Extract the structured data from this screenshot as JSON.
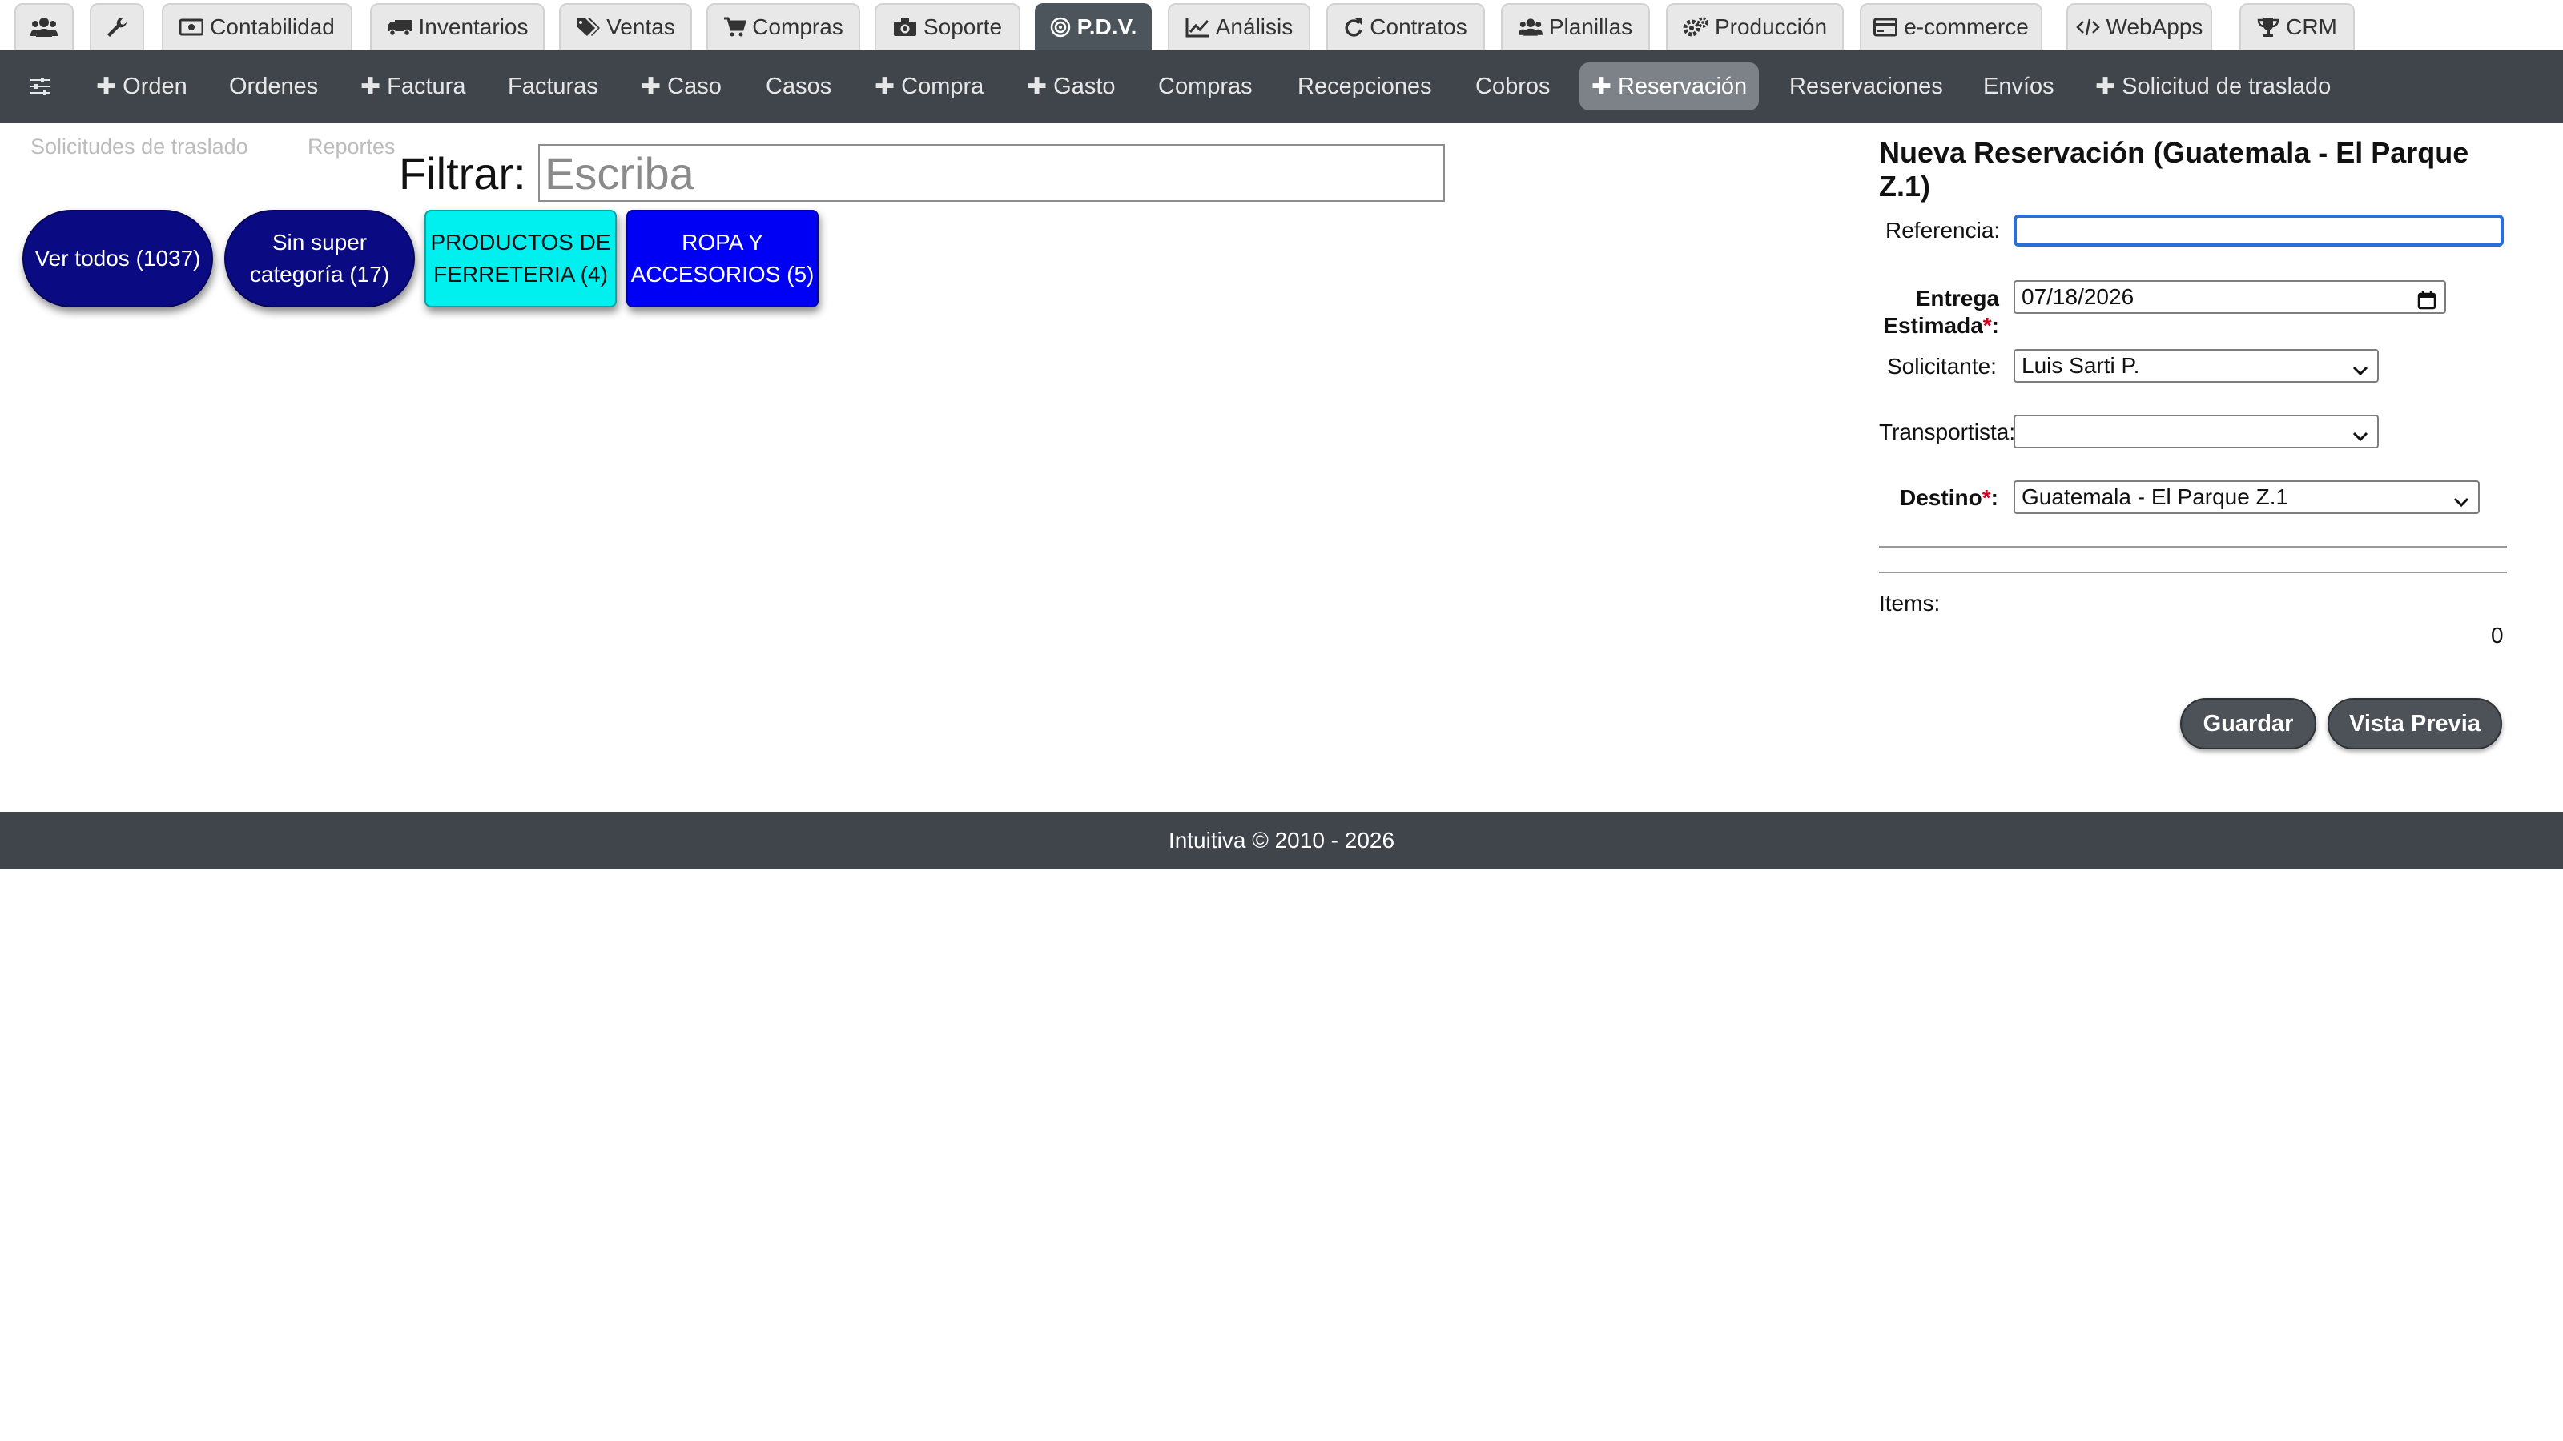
{
  "top_tabs": [
    {
      "label": "",
      "icon": "users-icon"
    },
    {
      "label": "",
      "icon": "wrench-icon"
    },
    {
      "label": "Contabilidad",
      "icon": "money-icon"
    },
    {
      "label": "Inventarios",
      "icon": "truck-icon"
    },
    {
      "label": "Ventas",
      "icon": "tags-icon"
    },
    {
      "label": "Compras",
      "icon": "cart-icon"
    },
    {
      "label": "Soporte",
      "icon": "camera-icon"
    },
    {
      "label": "P.D.V.",
      "icon": "target-icon",
      "active": true
    },
    {
      "label": "Análisis",
      "icon": "chart-icon"
    },
    {
      "label": "Contratos",
      "icon": "refresh-icon"
    },
    {
      "label": "Planillas",
      "icon": "users-icon"
    },
    {
      "label": "Producción",
      "icon": "gears-icon"
    },
    {
      "label": "e-commerce",
      "icon": "credit-card-icon"
    },
    {
      "label": "WebApps",
      "icon": "code-icon"
    },
    {
      "label": "CRM",
      "icon": "trophy-icon"
    }
  ],
  "subnav": [
    {
      "label": "",
      "icon": "sliders-icon"
    },
    {
      "label": "Orden",
      "plus": true
    },
    {
      "label": "Ordenes"
    },
    {
      "label": "Factura",
      "plus": true
    },
    {
      "label": "Facturas"
    },
    {
      "label": "Caso",
      "plus": true
    },
    {
      "label": "Casos"
    },
    {
      "label": "Compra",
      "plus": true
    },
    {
      "label": "Gasto",
      "plus": true
    },
    {
      "label": "Compras"
    },
    {
      "label": "Recepciones"
    },
    {
      "label": "Cobros"
    },
    {
      "label": "Reservación",
      "plus": true,
      "active": true
    },
    {
      "label": "Reservaciones"
    },
    {
      "label": "Envíos"
    },
    {
      "label": "Solicitud de traslado",
      "plus": true
    }
  ],
  "left": {
    "link_transfers": "Solicitudes de traslado",
    "link_reports": "Reportes",
    "filter_label": "Filtrar:",
    "filter_placeholder": "Escriba",
    "categories": [
      {
        "line1": "Ver todos (1037)",
        "line2": "",
        "color": "#0a0a82"
      },
      {
        "line1": "Sin super",
        "line2": "categoría (17)",
        "color": "#0a0a82"
      },
      {
        "line1": "PRODUCTOS DE",
        "line2": "FERRETERIA (4)",
        "color": "#00f0f0"
      },
      {
        "line1": "ROPA Y",
        "line2": "ACCESORIOS (5)",
        "color": "#0000f5"
      }
    ]
  },
  "form": {
    "title": "Nueva Reservación (Guatemala - El Parque Z.1)",
    "referencia_label": "Referencia:",
    "referencia_value": "",
    "entrega_label_1": "Entrega",
    "entrega_label_2": "Estimada",
    "entrega_value": "07/18/2026",
    "solicitante_label": "Solicitante:",
    "solicitante_value": "Luis Sarti P.",
    "transportista_label": "Transportista:",
    "transportista_value": "",
    "destino_label": "Destino",
    "destino_value": "Guatemala - El Parque Z.1",
    "required_mark": "*",
    "colon": ":",
    "items_label": "Items:",
    "items_count": "0",
    "save_label": "Guardar",
    "preview_label": "Vista Previa"
  },
  "footer": {
    "text": "Intuitiva © 2010 - 2026"
  },
  "colors": {
    "accent_blue": "#2a6fd6",
    "nav_bg": "#3f454b",
    "active_tab": "#4c545c",
    "required": "#d0021b"
  }
}
